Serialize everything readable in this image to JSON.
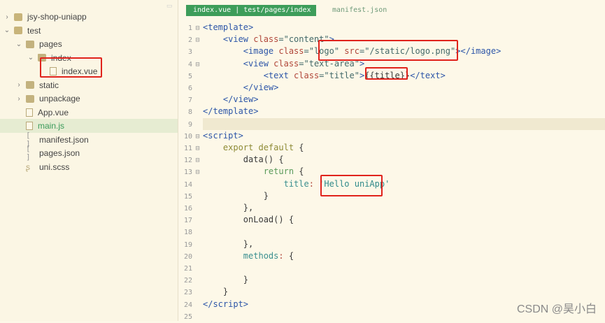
{
  "sidebar": {
    "items": [
      {
        "label": "jsy-shop-uniapp",
        "icon": "project-icon",
        "chevron": "›",
        "depth": 0
      },
      {
        "label": "test",
        "icon": "project-icon",
        "chevron": "⌄",
        "depth": 0
      },
      {
        "label": "pages",
        "icon": "folder-icon",
        "chevron": "⌄",
        "depth": 1
      },
      {
        "label": "index",
        "icon": "folder-icon",
        "chevron": "⌄",
        "depth": 2
      },
      {
        "label": "index.vue",
        "icon": "vue-file-icon",
        "chevron": "",
        "depth": 3
      },
      {
        "label": "static",
        "icon": "folder-icon",
        "chevron": "›",
        "depth": 1
      },
      {
        "label": "unpackage",
        "icon": "folder-icon",
        "chevron": "›",
        "depth": 1
      },
      {
        "label": "App.vue",
        "icon": "vue-file-icon",
        "chevron": "",
        "depth": 1
      },
      {
        "label": "main.js",
        "icon": "js-file-icon",
        "chevron": "",
        "depth": 1,
        "selected": true
      },
      {
        "label": "manifest.json",
        "icon": "json-file-icon",
        "chevron": "",
        "depth": 1
      },
      {
        "label": "pages.json",
        "icon": "json-file-icon",
        "chevron": "",
        "depth": 1
      },
      {
        "label": "uni.scss",
        "icon": "scss-file-icon",
        "chevron": "",
        "depth": 1
      }
    ]
  },
  "tabs": {
    "active": "index.vue | test/pages/index",
    "other": "manifest.json"
  },
  "code": [
    {
      "n": "1",
      "fold": "⊟",
      "tokens": [
        [
          "<template>",
          "tag"
        ]
      ]
    },
    {
      "n": "2",
      "fold": "⊟",
      "tokens": [
        [
          "    <view ",
          "tag"
        ],
        [
          "class",
          "attr"
        ],
        [
          "=\"content\"",
          "str"
        ],
        [
          ">",
          "tag"
        ]
      ]
    },
    {
      "n": "3",
      "fold": "",
      "tokens": [
        [
          "        <image ",
          "tag"
        ],
        [
          "class",
          "attr"
        ],
        [
          "=\"logo\" ",
          "str"
        ],
        [
          "src",
          "attr"
        ],
        [
          "=\"/static/logo.png\"",
          "str"
        ],
        [
          "></image>",
          "tag"
        ]
      ]
    },
    {
      "n": "4",
      "fold": "⊟",
      "tokens": [
        [
          "        <view ",
          "tag"
        ],
        [
          "class",
          "attr"
        ],
        [
          "=\"text-area\"",
          "str"
        ],
        [
          ">",
          "tag"
        ]
      ]
    },
    {
      "n": "5",
      "fold": "",
      "tokens": [
        [
          "            <text ",
          "tag"
        ],
        [
          "class",
          "attr"
        ],
        [
          "=\"title\"",
          "str"
        ],
        [
          ">",
          "tag"
        ],
        [
          "{{title}}",
          "p"
        ],
        [
          "</text>",
          "tag"
        ]
      ]
    },
    {
      "n": "6",
      "fold": "",
      "tokens": [
        [
          "        </view>",
          "tag"
        ]
      ]
    },
    {
      "n": "7",
      "fold": "",
      "tokens": [
        [
          "    </view>",
          "tag"
        ]
      ]
    },
    {
      "n": "8",
      "fold": "",
      "tokens": [
        [
          "</template>",
          "tag"
        ]
      ]
    },
    {
      "n": "9",
      "fold": "",
      "tokens": [],
      "highlight": true
    },
    {
      "n": "10",
      "fold": "⊟",
      "tokens": [
        [
          "<script>",
          "tag"
        ]
      ]
    },
    {
      "n": "11",
      "fold": "⊟",
      "tokens": [
        [
          "    export default ",
          "kw"
        ],
        [
          "{",
          "p"
        ]
      ]
    },
    {
      "n": "12",
      "fold": "⊟",
      "tokens": [
        [
          "        data",
          "id"
        ],
        [
          "() {",
          "p"
        ]
      ]
    },
    {
      "n": "13",
      "fold": "⊟",
      "tokens": [
        [
          "            return ",
          "kw2"
        ],
        [
          "{",
          "p"
        ]
      ]
    },
    {
      "n": "14",
      "fold": "",
      "tokens": [
        [
          "                title",
          "prop"
        ],
        [
          ": ",
          "attr"
        ],
        [
          "'Hello uniApp'",
          "sv"
        ]
      ]
    },
    {
      "n": "15",
      "fold": "",
      "tokens": [
        [
          "            }",
          "p"
        ]
      ]
    },
    {
      "n": "16",
      "fold": "",
      "tokens": [
        [
          "        },",
          "p"
        ]
      ]
    },
    {
      "n": "17",
      "fold": "",
      "tokens": [
        [
          "        onLoad",
          "id"
        ],
        [
          "() {",
          "p"
        ]
      ]
    },
    {
      "n": "18",
      "fold": "",
      "tokens": []
    },
    {
      "n": "19",
      "fold": "",
      "tokens": [
        [
          "        },",
          "p"
        ]
      ]
    },
    {
      "n": "20",
      "fold": "",
      "tokens": [
        [
          "        methods",
          "prop"
        ],
        [
          ": ",
          "attr"
        ],
        [
          "{",
          "p"
        ]
      ]
    },
    {
      "n": "21",
      "fold": "",
      "tokens": []
    },
    {
      "n": "22",
      "fold": "",
      "tokens": [
        [
          "        }",
          "p"
        ]
      ]
    },
    {
      "n": "23",
      "fold": "",
      "tokens": [
        [
          "    }",
          "p"
        ]
      ]
    },
    {
      "n": "24",
      "fold": "",
      "tokens": [
        [
          "</script>",
          "tag"
        ]
      ]
    },
    {
      "n": "25",
      "fold": "",
      "tokens": []
    }
  ],
  "watermark": "CSDN @昊小白",
  "colors": {
    "accent": "#3d9d5a",
    "annotation": "#e0231c",
    "background": "#fdf8e8"
  }
}
